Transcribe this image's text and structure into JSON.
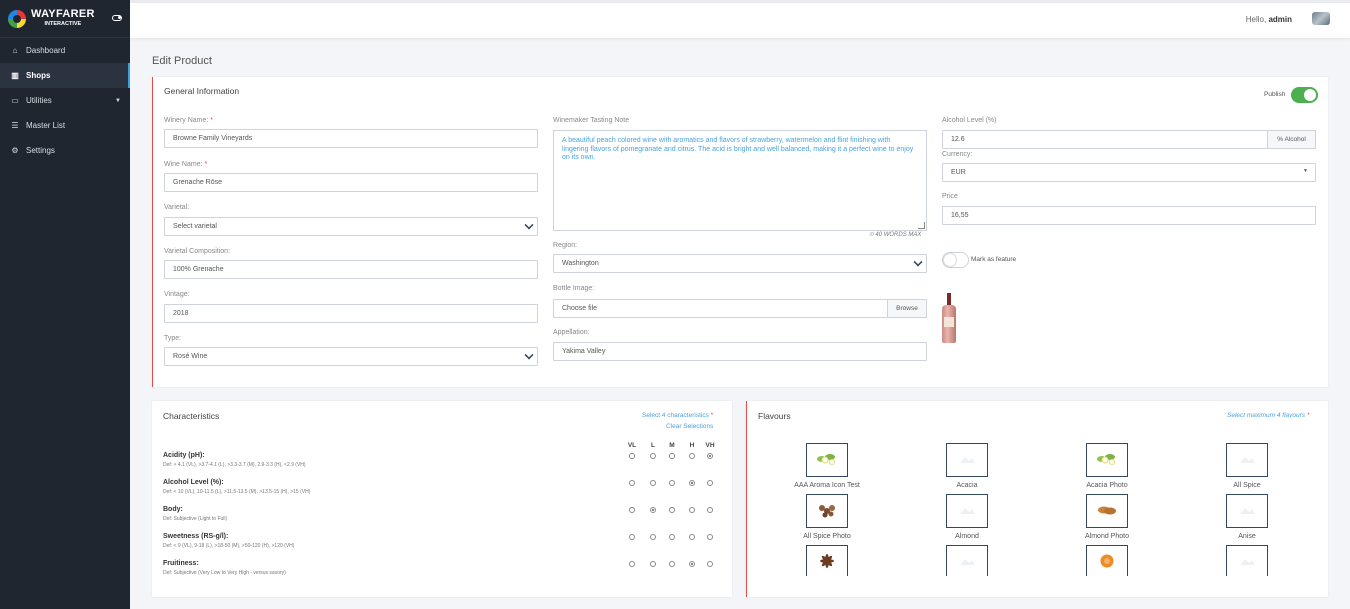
{
  "app": {
    "name": "WAYFARER",
    "subname": "INTERACTIVE"
  },
  "sidebar": {
    "items": [
      {
        "label": "Dashboard",
        "icon": "home-icon"
      },
      {
        "label": "Shops",
        "icon": "table-icon",
        "active": true
      },
      {
        "label": "Utilities",
        "icon": "monitor-icon",
        "has_submenu": true
      },
      {
        "label": "Master List",
        "icon": "list-icon"
      },
      {
        "label": "Settings",
        "icon": "gear-icon"
      }
    ]
  },
  "header": {
    "greeting": "Hello,",
    "user": "admin"
  },
  "page": {
    "title": "Edit Product"
  },
  "general": {
    "title": "General Information",
    "publish_label": "Publish",
    "publish_on": true,
    "winery_label": "Winery Name:",
    "winery_value": "Browne Family Vineyards",
    "wine_label": "Wine Name:",
    "wine_value": "Grenache Rōse",
    "varietal_label": "Varietal:",
    "varietal_value": "Select varietal",
    "composition_label": "Varietal Composition:",
    "composition_value": "100% Grenache",
    "vintage_label": "Vintage:",
    "vintage_value": "2018",
    "type_label": "Type:",
    "type_value": "Rosé Wine",
    "tasting_label": "Winemaker Tasting Note",
    "tasting_value": "A beautiful peach colored wine with aromatics and flavors of strawberry, watermelon and flint finishing with lingering flavors of pomegranate and citrus. The acid is bright and well balanced, making it a perfect wine to enjoy on its own.",
    "words_max": "40 WORDS MAX",
    "region_label": "Region:",
    "region_value": "Washington",
    "bottle_label": "Bottle Image:",
    "bottle_placeholder": "Choose file",
    "browse_label": "Browse",
    "appellation_label": "Appellation:",
    "appellation_value": "Yakima Valley",
    "alcohol_label": "Alcohol Level (%)",
    "alcohol_value": "12.6",
    "alcohol_addon": "% Alcohol",
    "currency_label": "Currency:",
    "currency_value": "EUR",
    "price_label": "Price",
    "price_value": "16,55",
    "feature_label": "Mark as feature",
    "feature_on": false,
    "required_mark": "*"
  },
  "characteristics": {
    "title": "Characteristics",
    "hint": "Select 4 characteristics",
    "clear_label": "Clear Selections",
    "scale": [
      "VL",
      "L",
      "M",
      "H",
      "VH"
    ],
    "rows": [
      {
        "name": "Acidity (pH):",
        "def": "Def: > 4.1 (VL), >3.7-4.1 (L), >3.3-3.7 (M), 2.9-3.3 (H), <2.9 (VH)",
        "selected": 4
      },
      {
        "name": "Alcohol Level (%):",
        "def": "Def: < 10 (VL), 10-11.5 (L), >11.5-13.5 (M), >13.5-15 (H), >15 (VH)",
        "selected": 3
      },
      {
        "name": "Body:",
        "def": "Def: Subjective (Light to Full)",
        "selected": 1
      },
      {
        "name": "Sweetness (RS-g/l):",
        "def": "Def: < 9 (VL), 9-18 (L), >18-50 (M), >50-120 (H), >120 (VH)",
        "selected": -1
      },
      {
        "name": "Fruitiness:",
        "def": "Def: Subjective (Very Low to Very High - versus savory)",
        "selected": 3
      }
    ]
  },
  "flavours": {
    "title": "Flavours",
    "hint": "Select maximum 4 flavours",
    "items": [
      {
        "label": "AAA Aroma Icon Test",
        "icon": "flower-icon"
      },
      {
        "label": "Acacia",
        "icon": "placeholder-icon"
      },
      {
        "label": "Acacia Photo",
        "icon": "flower-icon"
      },
      {
        "label": "All Spice",
        "icon": "placeholder-icon"
      },
      {
        "label": "All Spice Photo",
        "icon": "spice-icon"
      },
      {
        "label": "Almond",
        "icon": "placeholder-icon"
      },
      {
        "label": "Almond Photo",
        "icon": "almond-icon"
      },
      {
        "label": "Anise",
        "icon": "placeholder-icon"
      },
      {
        "label": "",
        "icon": "star-anise-icon"
      },
      {
        "label": "",
        "icon": "placeholder-icon"
      },
      {
        "label": "",
        "icon": "apricot-icon"
      },
      {
        "label": "",
        "icon": "placeholder-icon"
      }
    ]
  }
}
